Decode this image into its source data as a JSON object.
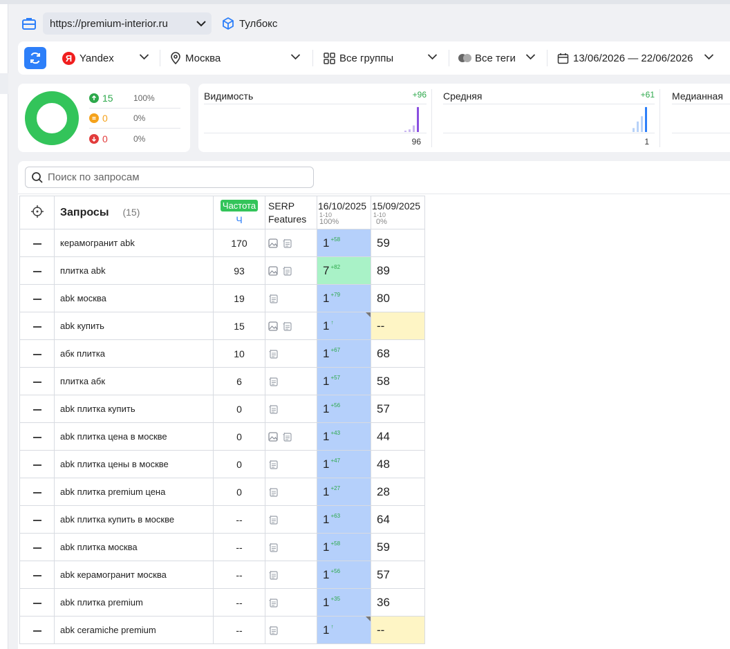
{
  "toolbar": {
    "url": "https://premium-interior.ru",
    "toolbox_label": "Тулбокс"
  },
  "filters": {
    "engine": "Yandex",
    "region": "Москва",
    "groups": "Все группы",
    "tags": "Все теги",
    "dates": "13/06/2026 — 22/06/2026"
  },
  "summary": {
    "up_count": "15",
    "up_pct": "100%",
    "same_count": "0",
    "same_pct": "0%",
    "down_count": "0",
    "down_pct": "0%"
  },
  "metrics": [
    {
      "title": "Видимость",
      "delta": "+96",
      "value": "96",
      "bars": [
        0.05,
        0.1,
        0.25,
        0.95
      ],
      "colors": [
        "#c9b6f0",
        "#c9b6f0",
        "#c9b6f0",
        "#8a4fe0"
      ]
    },
    {
      "title": "Средняя",
      "delta": "+61",
      "value": "1",
      "bars": [
        0.15,
        0.4,
        0.6,
        0.95
      ],
      "colors": [
        "#b8d2f8",
        "#b8d2f8",
        "#b8d2f8",
        "#2d7ff9"
      ]
    },
    {
      "title": "Медианная",
      "delta": "",
      "value": "",
      "bars": [],
      "colors": []
    }
  ],
  "search": {
    "placeholder": "Поиск по запросам"
  },
  "table": {
    "header_queries": "Запросы",
    "header_count": "(15)",
    "header_freq_badge": "Частота",
    "header_freq_sub": "Ч",
    "header_serp_1": "SERP",
    "header_serp_2": "Features",
    "date1": "16/10/2025",
    "date1_range": "1-10",
    "date1_pct": "100%",
    "date2": "15/09/2025",
    "date2_range": "1-10",
    "date2_pct": "0%"
  },
  "rows": [
    {
      "query": "керамогранит abk",
      "freq": "170",
      "serp": [
        "image",
        "feature"
      ],
      "pos1": "1",
      "delta1": "+58",
      "color1": "blue",
      "corner": false,
      "pos2": "59",
      "color2": ""
    },
    {
      "query": "плитка abk",
      "freq": "93",
      "serp": [
        "image",
        "feature"
      ],
      "pos1": "7",
      "delta1": "+82",
      "color1": "green",
      "corner": false,
      "pos2": "89",
      "color2": ""
    },
    {
      "query": "abk москва",
      "freq": "19",
      "serp": [
        "feature"
      ],
      "pos1": "1",
      "delta1": "+79",
      "color1": "blue",
      "corner": false,
      "pos2": "80",
      "color2": ""
    },
    {
      "query": "abk купить",
      "freq": "15",
      "serp": [
        "image",
        "feature"
      ],
      "pos1": "1",
      "delta1": "↑",
      "color1": "blue",
      "corner": true,
      "pos2": "--",
      "color2": "yellow"
    },
    {
      "query": "абк плитка",
      "freq": "10",
      "serp": [
        "feature"
      ],
      "pos1": "1",
      "delta1": "+67",
      "color1": "blue",
      "corner": false,
      "pos2": "68",
      "color2": ""
    },
    {
      "query": "плитка абк",
      "freq": "6",
      "serp": [
        "feature"
      ],
      "pos1": "1",
      "delta1": "+57",
      "color1": "blue",
      "corner": false,
      "pos2": "58",
      "color2": ""
    },
    {
      "query": "abk плитка купить",
      "freq": "0",
      "serp": [
        "feature"
      ],
      "pos1": "1",
      "delta1": "+56",
      "color1": "blue",
      "corner": false,
      "pos2": "57",
      "color2": ""
    },
    {
      "query": "abk плитка цена в москве",
      "freq": "0",
      "serp": [
        "image",
        "feature"
      ],
      "pos1": "1",
      "delta1": "+43",
      "color1": "blue",
      "corner": false,
      "pos2": "44",
      "color2": ""
    },
    {
      "query": "abk плитка цены в москве",
      "freq": "0",
      "serp": [
        "feature"
      ],
      "pos1": "1",
      "delta1": "+47",
      "color1": "blue",
      "corner": false,
      "pos2": "48",
      "color2": ""
    },
    {
      "query": "abk плитка premium цена",
      "freq": "0",
      "serp": [
        "feature"
      ],
      "pos1": "1",
      "delta1": "+27",
      "color1": "blue",
      "corner": false,
      "pos2": "28",
      "color2": ""
    },
    {
      "query": "abk плитка купить в москве",
      "freq": "--",
      "serp": [
        "feature"
      ],
      "pos1": "1",
      "delta1": "+63",
      "color1": "blue",
      "corner": false,
      "pos2": "64",
      "color2": ""
    },
    {
      "query": "abk плитка москва",
      "freq": "--",
      "serp": [
        "feature"
      ],
      "pos1": "1",
      "delta1": "+58",
      "color1": "blue",
      "corner": false,
      "pos2": "59",
      "color2": ""
    },
    {
      "query": "abk керамогранит москва",
      "freq": "--",
      "serp": [
        "feature"
      ],
      "pos1": "1",
      "delta1": "+56",
      "color1": "blue",
      "corner": false,
      "pos2": "57",
      "color2": ""
    },
    {
      "query": "abk плитка premium",
      "freq": "--",
      "serp": [
        "feature"
      ],
      "pos1": "1",
      "delta1": "+35",
      "color1": "blue",
      "corner": false,
      "pos2": "36",
      "color2": ""
    },
    {
      "query": "abk ceramiche premium",
      "freq": "--",
      "serp": [
        "feature"
      ],
      "pos1": "1",
      "delta1": "↑",
      "color1": "blue",
      "corner": true,
      "pos2": "--",
      "color2": "yellow"
    }
  ]
}
